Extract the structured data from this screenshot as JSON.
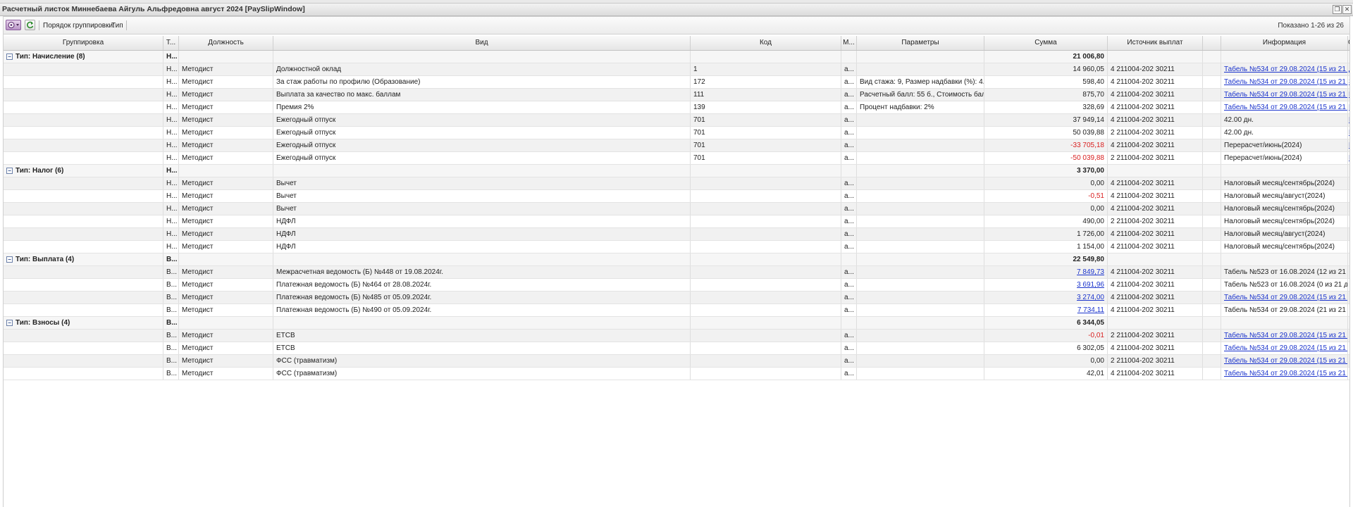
{
  "window": {
    "title": "Расчетный листок Миннебаева Айгуль Альфредовна август 2024 [PaySlipWindow]"
  },
  "toolbar": {
    "grouping_label": "Порядок группировки:",
    "grouping_value": "Тип",
    "shown_text": "Показано 1-26 из 26"
  },
  "columns": [
    "Группировка",
    "Т...",
    "Должность",
    "Вид",
    "Код",
    "М...",
    "Параметры",
    "Сумма",
    "Источник выплат",
    "",
    "Информация",
    "C"
  ],
  "groups": [
    {
      "label": "Тип: Начисление (8)",
      "type_short": "Н...",
      "total": "21 006,80",
      "rows": [
        {
          "t": "Н...",
          "pos": "Методист",
          "kind": "Должностной оклад",
          "code": "1",
          "m": "а...",
          "params": "",
          "sum": "14 960,05",
          "neg": false,
          "link_sum": false,
          "source": "4 211004-202 30211",
          "info": "Табель №534 от 29.08.2024 (15 из 21 ...",
          "info_link": true,
          "extra": "Д"
        },
        {
          "t": "Н...",
          "pos": "Методист",
          "kind": "За стаж работы по профилю (Образование)",
          "code": "172",
          "m": "а...",
          "params": "Вид стажа: 9, Размер надбавки (%): 4...",
          "sum": "598,40",
          "neg": false,
          "link_sum": false,
          "source": "4 211004-202 30211",
          "info": "Табель №534 от 29.08.2024 (15 из 21 ...",
          "info_link": true,
          "extra": "З"
        },
        {
          "t": "Н...",
          "pos": "Методист",
          "kind": "Выплата за качество по макс. баллам",
          "code": "111",
          "m": "а...",
          "params": "Расчетный балл: 55 б., Стоимость бал...",
          "sum": "875,70",
          "neg": false,
          "link_sum": false,
          "source": "4 211004-202 30211",
          "info": "Табель №534 от 29.08.2024 (15 из 21 ...",
          "info_link": true,
          "extra": "В"
        },
        {
          "t": "Н...",
          "pos": "Методист",
          "kind": "Премия 2%",
          "code": "139",
          "m": "а...",
          "params": "Процент надбавки: 2%",
          "sum": "328,69",
          "neg": false,
          "link_sum": false,
          "source": "4 211004-202 30211",
          "info": "Табель №534 от 29.08.2024 (15 из 21 ...",
          "info_link": true,
          "extra": "П"
        },
        {
          "t": "Н...",
          "pos": "Методист",
          "kind": "Ежегодный отпуск",
          "code": "701",
          "m": "а...",
          "params": "",
          "sum": "37 949,14",
          "neg": false,
          "link_sum": false,
          "source": "4 211004-202 30211",
          "info": "42.00 дн.",
          "info_link": false,
          "extra": "П"
        },
        {
          "t": "Н...",
          "pos": "Методист",
          "kind": "Ежегодный отпуск",
          "code": "701",
          "m": "а...",
          "params": "",
          "sum": "50 039,88",
          "neg": false,
          "link_sum": false,
          "source": "2 211004-202 30211",
          "info": "42.00 дн.",
          "info_link": false,
          "extra": "П"
        },
        {
          "t": "Н...",
          "pos": "Методист",
          "kind": "Ежегодный отпуск",
          "code": "701",
          "m": "а...",
          "params": "",
          "sum": "-33 705,18",
          "neg": true,
          "link_sum": false,
          "source": "4 211004-202 30211",
          "info": "Перерасчет/июнь(2024)",
          "info_link": false,
          "extra": "П"
        },
        {
          "t": "Н...",
          "pos": "Методист",
          "kind": "Ежегодный отпуск",
          "code": "701",
          "m": "а...",
          "params": "",
          "sum": "-50 039,88",
          "neg": true,
          "link_sum": false,
          "source": "2 211004-202 30211",
          "info": "Перерасчет/июнь(2024)",
          "info_link": false,
          "extra": "П"
        }
      ]
    },
    {
      "label": "Тип: Налог (6)",
      "type_short": "Н...",
      "total": "3 370,00",
      "rows": [
        {
          "t": "Н...",
          "pos": "Методист",
          "kind": "Вычет",
          "code": "",
          "m": "а...",
          "params": "",
          "sum": "0,00",
          "neg": false,
          "link_sum": false,
          "source": "4 211004-202 30211",
          "info": "Налоговый месяц/сентябрь(2024)",
          "info_link": false,
          "extra": ""
        },
        {
          "t": "Н...",
          "pos": "Методист",
          "kind": "Вычет",
          "code": "",
          "m": "а...",
          "params": "",
          "sum": "-0,51",
          "neg": true,
          "link_sum": false,
          "source": "4 211004-202 30211",
          "info": "Налоговый месяц/август(2024)",
          "info_link": false,
          "extra": ""
        },
        {
          "t": "Н...",
          "pos": "Методист",
          "kind": "Вычет",
          "code": "",
          "m": "а...",
          "params": "",
          "sum": "0,00",
          "neg": false,
          "link_sum": false,
          "source": "4 211004-202 30211",
          "info": "Налоговый месяц/сентябрь(2024)",
          "info_link": false,
          "extra": ""
        },
        {
          "t": "Н...",
          "pos": "Методист",
          "kind": "НДФЛ",
          "code": "",
          "m": "а...",
          "params": "",
          "sum": "490,00",
          "neg": false,
          "link_sum": false,
          "source": "2 211004-202 30211",
          "info": "Налоговый месяц/сентябрь(2024)",
          "info_link": false,
          "extra": ""
        },
        {
          "t": "Н...",
          "pos": "Методист",
          "kind": "НДФЛ",
          "code": "",
          "m": "а...",
          "params": "",
          "sum": "1 726,00",
          "neg": false,
          "link_sum": false,
          "source": "4 211004-202 30211",
          "info": "Налоговый месяц/август(2024)",
          "info_link": false,
          "extra": ""
        },
        {
          "t": "Н...",
          "pos": "Методист",
          "kind": "НДФЛ",
          "code": "",
          "m": "а...",
          "params": "",
          "sum": "1 154,00",
          "neg": false,
          "link_sum": false,
          "source": "4 211004-202 30211",
          "info": "Налоговый месяц/сентябрь(2024)",
          "info_link": false,
          "extra": ""
        }
      ]
    },
    {
      "label": "Тип: Выплата (4)",
      "type_short": "В...",
      "total": "22 549,80",
      "rows": [
        {
          "t": "В...",
          "pos": "Методист",
          "kind": "Межрасчетная ведомость (Б) №448 от 19.08.2024г.",
          "code": "",
          "m": "а...",
          "params": "",
          "sum": "7 849,73",
          "neg": false,
          "link_sum": true,
          "source": "4 211004-202 30211",
          "info": "Табель №523 от 16.08.2024 (12 из 21 ...",
          "info_link": false,
          "extra": ""
        },
        {
          "t": "В...",
          "pos": "Методист",
          "kind": "Платежная ведомость (Б) №464 от 28.08.2024г.",
          "code": "",
          "m": "а...",
          "params": "",
          "sum": "3 691,96",
          "neg": false,
          "link_sum": true,
          "source": "4 211004-202 30211",
          "info": "Табель №523 от 16.08.2024 (0 из 21 д...",
          "info_link": false,
          "extra": ""
        },
        {
          "t": "В...",
          "pos": "Методист",
          "kind": "Платежная ведомость (Б) №485 от 05.09.2024г.",
          "code": "",
          "m": "а...",
          "params": "",
          "sum": "3 274,00",
          "neg": false,
          "link_sum": true,
          "source": "4 211004-202 30211",
          "info": "Табель №534 от 29.08.2024 (15 из 21 ...",
          "info_link": true,
          "extra": ""
        },
        {
          "t": "В...",
          "pos": "Методист",
          "kind": "Платежная ведомость (Б) №490 от 05.09.2024г.",
          "code": "",
          "m": "а...",
          "params": "",
          "sum": "7 734,11",
          "neg": false,
          "link_sum": true,
          "source": "4 211004-202 30211",
          "info": "Табель №534 от 29.08.2024 (21 из 21 ...",
          "info_link": false,
          "extra": ""
        }
      ]
    },
    {
      "label": "Тип: Взносы (4)",
      "type_short": "В...",
      "total": "6 344,05",
      "rows": [
        {
          "t": "В...",
          "pos": "Методист",
          "kind": "ЕТСВ",
          "code": "",
          "m": "а...",
          "params": "",
          "sum": "-0,01",
          "neg": true,
          "link_sum": false,
          "source": "2 211004-202 30211",
          "info": "Табель №534 от 29.08.2024 (15 из 21 ...",
          "info_link": true,
          "extra": ""
        },
        {
          "t": "В...",
          "pos": "Методист",
          "kind": "ЕТСВ",
          "code": "",
          "m": "а...",
          "params": "",
          "sum": "6 302,05",
          "neg": false,
          "link_sum": false,
          "source": "4 211004-202 30211",
          "info": "Табель №534 от 29.08.2024 (15 из 21 ...",
          "info_link": true,
          "extra": ""
        },
        {
          "t": "В...",
          "pos": "Методист",
          "kind": "ФСС (травматизм)",
          "code": "",
          "m": "а...",
          "params": "",
          "sum": "0,00",
          "neg": false,
          "link_sum": false,
          "source": "2 211004-202 30211",
          "info": "Табель №534 от 29.08.2024 (15 из 21 ...",
          "info_link": true,
          "extra": ""
        },
        {
          "t": "В...",
          "pos": "Методист",
          "kind": "ФСС (травматизм)",
          "code": "",
          "m": "а...",
          "params": "",
          "sum": "42,01",
          "neg": false,
          "link_sum": false,
          "source": "4 211004-202 30211",
          "info": "Табель №534 от 29.08.2024 (15 из 21 ...",
          "info_link": true,
          "extra": ""
        }
      ]
    }
  ],
  "colors": {
    "negative": "#d92020",
    "link": "#1a33cc",
    "row_alt": "#f1f1f1"
  }
}
